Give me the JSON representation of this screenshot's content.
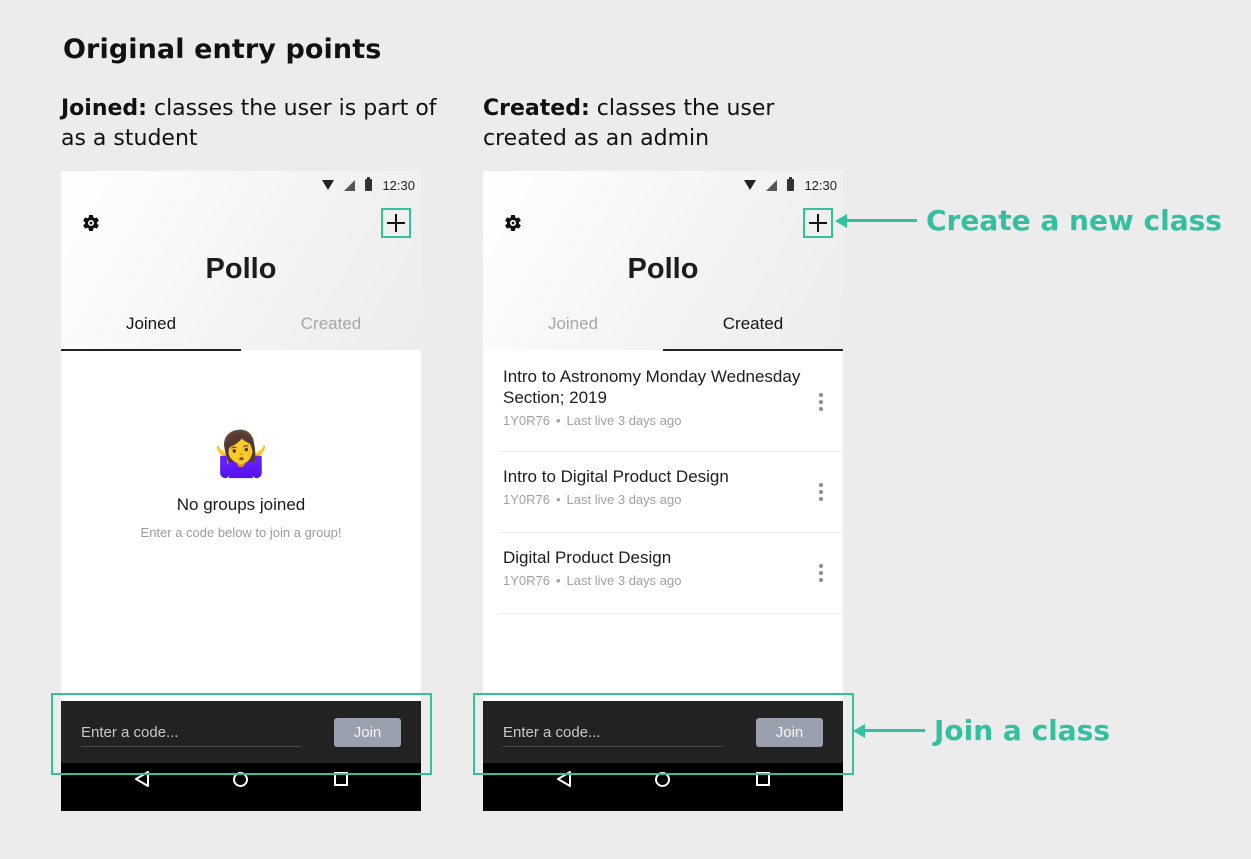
{
  "page": {
    "title": "Original entry points"
  },
  "captions": {
    "joined_bold": "Joined:",
    "joined_text": " classes the user is part of as a student",
    "created_bold": "Created:",
    "created_text": " classes the user created as an admin"
  },
  "status_bar": {
    "time": "12:30"
  },
  "app": {
    "title": "Pollo",
    "tabs": [
      "Joined",
      "Created"
    ]
  },
  "joined_screen": {
    "active_tab": "Joined",
    "empty_emoji": "🤷‍♀️",
    "empty_title": "No groups joined",
    "empty_subtitle": "Enter a code below to join a group!"
  },
  "created_screen": {
    "active_tab": "Created",
    "classes": [
      {
        "name": "Intro to Astronomy Monday Wednesday Section; 2019",
        "code": "1Y0R76",
        "last_live": "Last live 3 days ago"
      },
      {
        "name": "Intro to Digital Product Design",
        "code": "1Y0R76",
        "last_live": "Last live 3 days ago"
      },
      {
        "name": "Digital Product Design",
        "code": "1Y0R76",
        "last_live": "Last live 3 days ago"
      }
    ]
  },
  "join_bar": {
    "placeholder": "Enter a code...",
    "button_label": "Join"
  },
  "annotations": {
    "create": "Create a new class",
    "join": "Join a class"
  },
  "colors": {
    "accent": "#34c0a0",
    "join_bar": "#222222",
    "join_button": "#9aa0ad",
    "background": "#ececec"
  },
  "icons": {
    "settings": "gear-icon",
    "add": "plus-icon",
    "wifi": "wifi-icon",
    "signal": "signal-icon",
    "battery": "battery-icon",
    "back": "back-triangle-icon",
    "home": "home-circle-icon",
    "recents": "recents-square-icon",
    "more": "more-vertical-icon"
  }
}
